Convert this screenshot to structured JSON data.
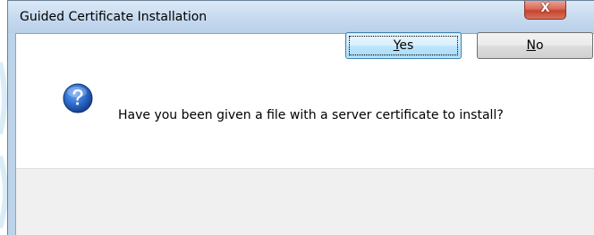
{
  "window": {
    "title": "Guided Certificate Installation",
    "close_glyph": "X"
  },
  "message": {
    "text": "Have you been given a file with a server certificate to install?",
    "icon": "question-icon"
  },
  "buttons": {
    "yes": {
      "mnemonic": "Y",
      "rest": "es"
    },
    "no": {
      "mnemonic": "N",
      "rest": "o"
    }
  },
  "colors": {
    "titlebar": "#c9dcf0",
    "close_button": "#c7442e",
    "button_bar": "#f0f0f0",
    "default_button_border": "#3c7fb1",
    "help_icon": "#1f5fbf"
  }
}
